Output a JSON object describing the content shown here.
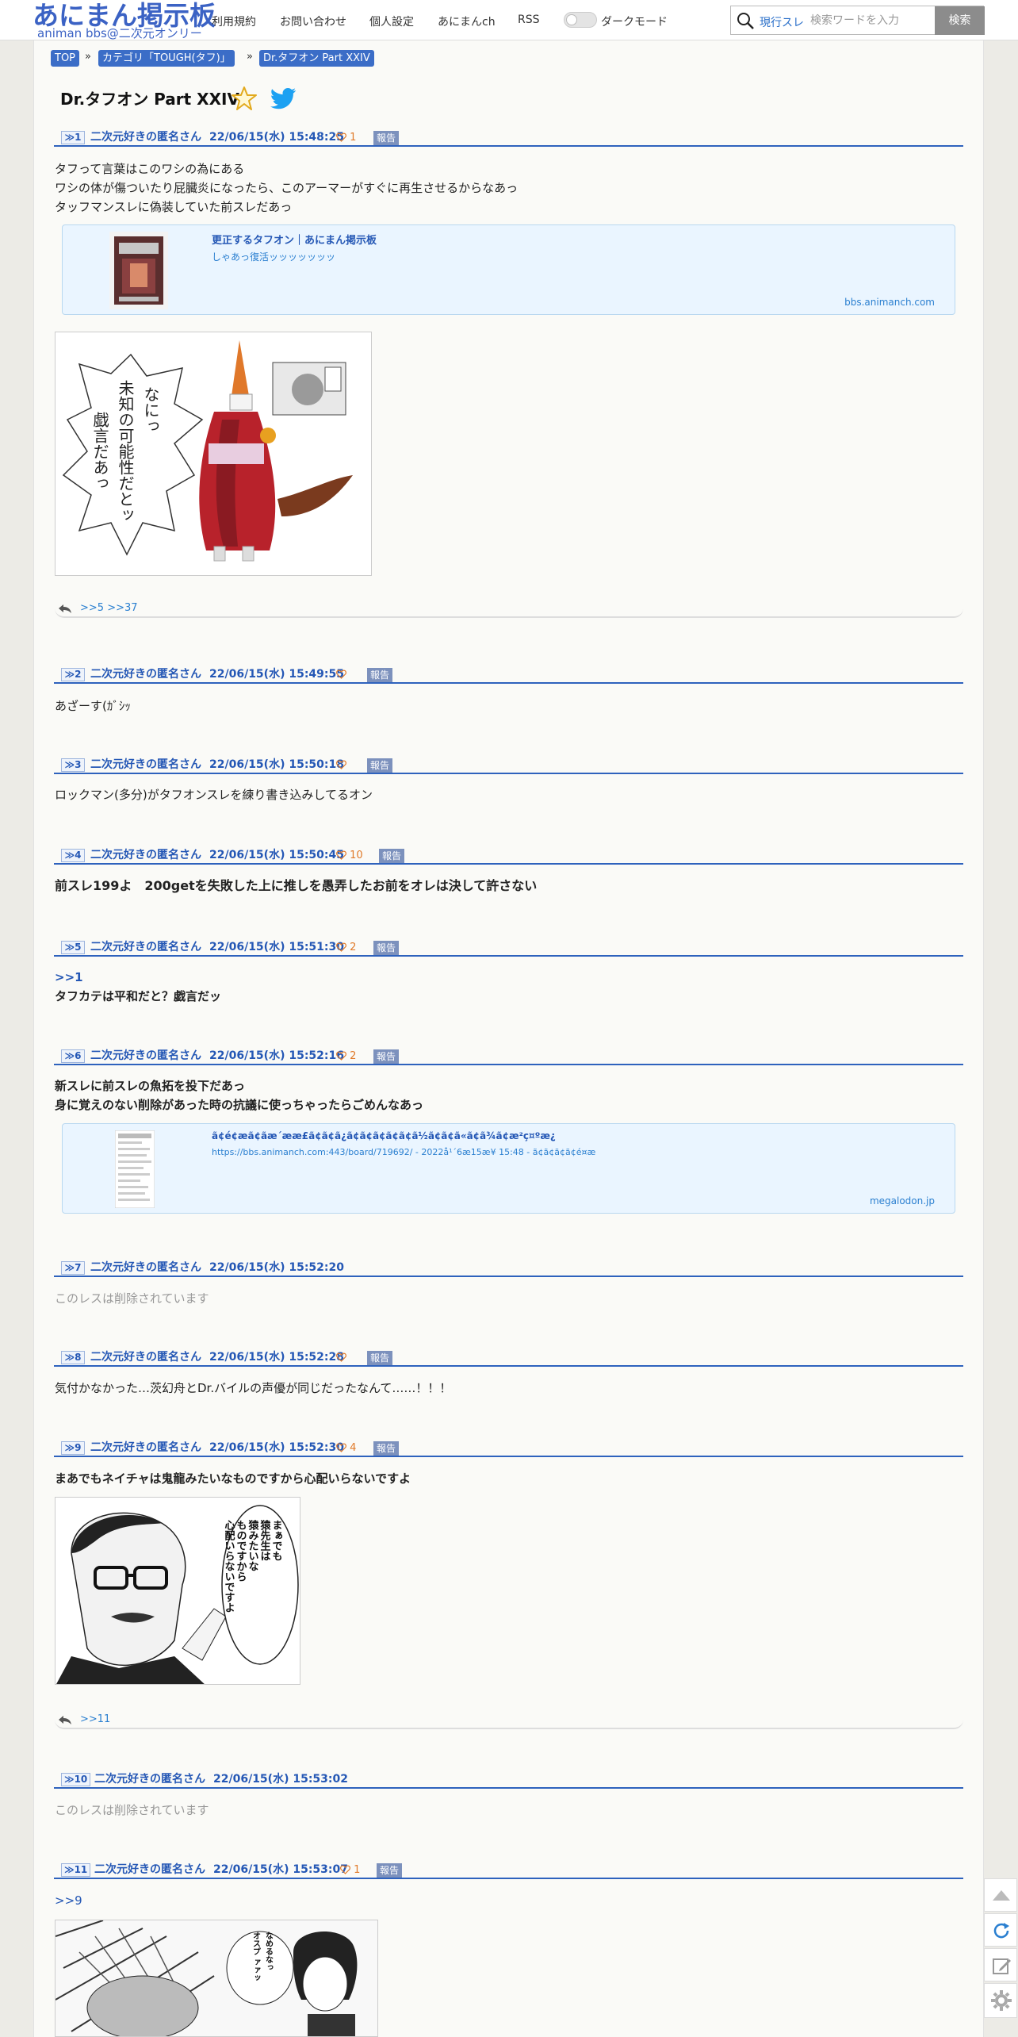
{
  "header": {
    "logo_main": "あにまん掲示板",
    "logo_sub": "animan bbs@二次元オンリー",
    "nav": [
      "利用規約",
      "お問い合わせ",
      "個人設定",
      "あにまんch",
      "RSS"
    ],
    "darkmode_label": "ダークモード",
    "search_scope": "現行スレ",
    "search_placeholder": "検索ワードを入力",
    "search_button": "検索"
  },
  "breadcrumb": {
    "items": [
      "TOP",
      "カテゴリ「TOUGH(タフ)」",
      "Dr.タフオン Part XXIV"
    ],
    "separator": "»"
  },
  "thread": {
    "title": "Dr.タフオン Part XXIV"
  },
  "posts": [
    {
      "num": "≫1",
      "name": "二次元好きの匿名さん",
      "date": "22/06/15(水) 15:48:25",
      "likes": "1",
      "report": "報告",
      "lines": [
        "タフって言葉はこのワシの為にある",
        "ワシの体が傷ついたり屁臓炎になったら、このアーマーがすぐに再生させるからなあっ",
        "タッフマンスレに偽装していた前スレだあっ"
      ],
      "card": {
        "title": "更正するタフオン｜あにまん掲示板",
        "desc": "しゃあっ復活ッッッッッッッ",
        "domain": "bbs.animanch.com"
      },
      "image_text": [
        "なにっ",
        "未知の可能性だとッ",
        "戯言だあっ"
      ],
      "replies": ">>5  >>37"
    },
    {
      "num": "≫2",
      "name": "二次元好きの匿名さん",
      "date": "22/06/15(水) 15:49:55",
      "likes": "",
      "report": "報告",
      "lines": [
        "あざーす(ｶﾞｼｯ"
      ]
    },
    {
      "num": "≫3",
      "name": "二次元好きの匿名さん",
      "date": "22/06/15(水) 15:50:18",
      "likes": "",
      "report": "報告",
      "lines": [
        "ロックマン(多分)がタフオンスレを練り書き込みしてるオン"
      ]
    },
    {
      "num": "≫4",
      "name": "二次元好きの匿名さん",
      "date": "22/06/15(水) 15:50:45",
      "likes": "10",
      "report": "報告",
      "lines": [
        "前スレ199よ　200getを失敗した上に推しを愚弄したお前をオレは決して許さない"
      ]
    },
    {
      "num": "≫5",
      "name": "二次元好きの匿名さん",
      "date": "22/06/15(水) 15:51:30",
      "likes": "2",
      "report": "報告",
      "anchor": ">>1",
      "lines": [
        "タフカテは平和だと？戯言だッ"
      ]
    },
    {
      "num": "≫6",
      "name": "二次元好きの匿名さん",
      "date": "22/06/15(水) 15:52:16",
      "likes": "2",
      "report": "報告",
      "lines": [
        "新スレに前スレの魚拓を投下だあっ",
        "身に覚えのない削除があった時の抗議に使っちゃったらごめんなあっ"
      ],
      "card": {
        "title": "ã¢é¢æã¢ãæ´ææ£ã¢ã¢ã¿ã¢ã¢ã¢ã¢ã¢ã½ã¢ã¢ã«ã¢ã¾ã¢æ²ç¤ºæ¿",
        "desc": "https://bbs.animanch.com:443/board/719692/ - 2022å¹´6æ15æ¥ 15:48 - ã¢ã¢ã¢ã¢é¤æ",
        "domain": "megalodon.jp"
      }
    },
    {
      "num": "≫7",
      "name": "二次元好きの匿名さん",
      "date": "22/06/15(水) 15:52:20",
      "deleted": "このレスは削除されています"
    },
    {
      "num": "≫8",
      "name": "二次元好きの匿名さん",
      "date": "22/06/15(水) 15:52:28",
      "likes": "",
      "report": "報告",
      "lines": [
        "気付かなかった…茨幻舟とDr.バイルの声優が同じだったなんて……！！！"
      ]
    },
    {
      "num": "≫9",
      "name": "二次元好きの匿名さん",
      "date": "22/06/15(水) 15:52:30",
      "likes": "4",
      "report": "報告",
      "lines": [
        "まあでもネイチャは鬼龍みたいなものですから心配いらないですよ"
      ],
      "image_text": [
        "まぁでも",
        "猿先生は",
        "猿みたいな",
        "ものですから",
        "心配いらないですよ"
      ],
      "replies": ">>11"
    },
    {
      "num": "≫10",
      "name": "二次元好きの匿名さん",
      "date": "22/06/15(水) 15:53:02",
      "deleted": "このレスは削除されています"
    },
    {
      "num": "≫11",
      "name": "二次元好きの匿名さん",
      "date": "22/06/15(水) 15:53:07",
      "likes": "1",
      "report": "報告",
      "anchor": ">>9",
      "image_text": [
        "なめるなっ",
        "オスプ ァァッ"
      ]
    }
  ],
  "colors": {
    "accent": "#2457b5",
    "breadcrumb_bg": "#3b6dc7",
    "heart": "#e07a2a",
    "report_bg": "#7c91bd",
    "card_bg": "#eaf5ff"
  },
  "side_buttons": [
    "scroll-top-icon",
    "refresh-icon",
    "edit-icon",
    "settings-icon"
  ]
}
